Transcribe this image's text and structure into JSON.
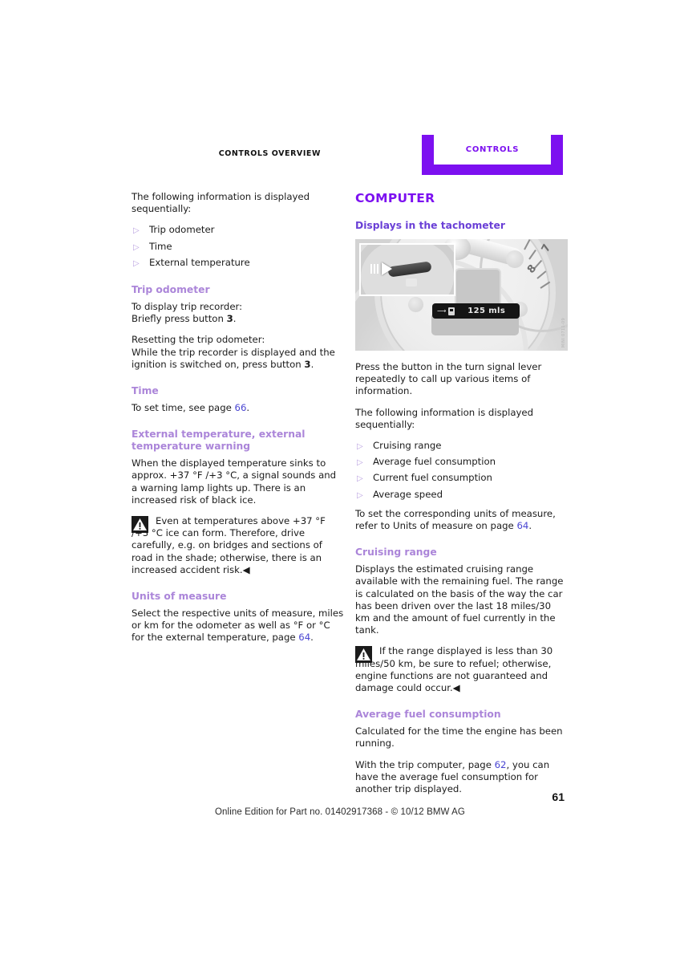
{
  "header": {
    "chapter_overview": "CONTROLS OVERVIEW",
    "tab_label": "CONTROLS",
    "tab_color": "#7c10f0"
  },
  "left_column": {
    "intro": "The following information is displayed sequentially:",
    "bullets": [
      "Trip odometer",
      "Time",
      "External temperature"
    ],
    "sections": [
      {
        "heading": "Trip odometer",
        "paragraphs": [
          "To display trip recorder:",
          "Briefly press button 3.",
          "Resetting the trip odometer:",
          "While the trip recorder is displayed and the ignition is switched on, press button 3."
        ]
      },
      {
        "heading": "Time",
        "paragraph_pre": "To set time, see page ",
        "page_ref": "66",
        "paragraph_post": "."
      },
      {
        "heading": "External temperature, external temperature warning",
        "paragraph": "When the displayed temperature sinks to approx. +37 °F /+3 °C, a signal sounds and a warning lamp lights up. There is an increased risk of black ice.",
        "warning": "Even at temperatures above +37 °F /+3 °C ice can form. Therefore, drive carefully, e.g. on bridges and sections of road in the shade; otherwise, there is an increased accident risk.◀"
      },
      {
        "heading": "Units of measure",
        "paragraph_pre": "Select the respective units of measure, miles or km for the odometer as well as °F  or  °C for the external temperature, page ",
        "page_ref": "64",
        "paragraph_post": "."
      }
    ]
  },
  "right_column": {
    "section_title": "COMPUTER",
    "sub_title": "Displays in the tachometer",
    "figure": {
      "lcd_value": "125 mls",
      "scale_labels": [
        "7",
        "8"
      ],
      "watermark": "MINI 0711-09"
    },
    "paragraphs": [
      "Press the button in the turn signal lever repeatedly to call up various items of information.",
      "The following information is displayed sequentially:"
    ],
    "bullets": [
      "Cruising range",
      "Average fuel consumption",
      "Current fuel consumption",
      "Average speed"
    ],
    "units_note_pre": "To set the corresponding units of measure, refer to Units of measure on page ",
    "units_note_ref": "64",
    "units_note_post": ".",
    "sections": [
      {
        "heading": "Cruising range",
        "paragraph": "Displays the estimated cruising range available with the remaining fuel. The range is calculated on the basis of the way the car has been driven over the last 18 miles/30 km and the amount of fuel currently in the tank.",
        "warning": "If the range displayed is less than 30 miles/50 km, be sure to refuel; otherwise, engine functions are not guaranteed and damage could occur.◀"
      },
      {
        "heading": "Average fuel consumption",
        "paragraph": "Calculated for the time the engine has been running.",
        "paragraph2_pre": "With the trip computer, page ",
        "page_ref": "62",
        "paragraph2_post": ", you can have the average fuel consumption for another trip displayed."
      }
    ]
  },
  "footer": {
    "text": "Online Edition for Part no. 01402917368 - © 10/12 BMW AG",
    "page_number": "61"
  }
}
